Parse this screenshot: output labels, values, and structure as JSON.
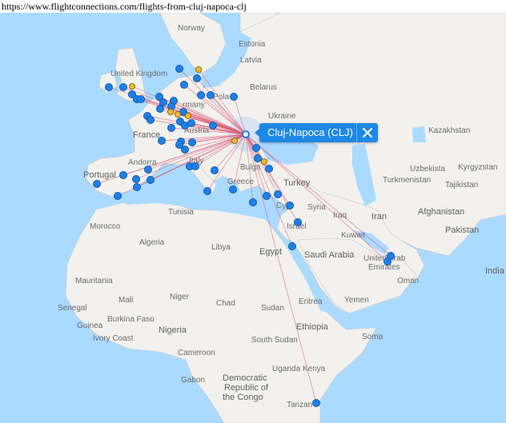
{
  "browser": {
    "url": "https://www.flightconnections.com/flights-from-cluj-napoca-clj"
  },
  "popup": {
    "label": "Cluj-Napoca (CLJ)",
    "close_icon": "close-icon"
  },
  "colors": {
    "water": "#aadaff",
    "land": "#f2f1ee",
    "route": "#d9536f",
    "airport": "#1e7fe8",
    "airport_alt": "#f5b82e",
    "popup": "#1e88e5"
  },
  "labels": {
    "norway": "Norway",
    "estonia": "Estonia",
    "latvia": "Latvia",
    "belarus": "Belarus",
    "uk": "United Kingdom",
    "poland": "Pola",
    "germany": "rmany",
    "ukraine": "Ukraine",
    "kazakhstan": "Kazakhstan",
    "france": "France",
    "austria": "Austria",
    "bulgaria": "Bulga",
    "andorra": "Andorra",
    "italy": "Italy",
    "portugal": "Portugal",
    "greece": "Greece",
    "turkey": "Turkey",
    "uzbekistan": "Uzbekista",
    "kyrgyzstan": "Kyrgyzstan",
    "turkmenistan": "Turkmenistan",
    "tajikistan": "Tajikistan",
    "cyprus": "Cyp",
    "syria": "Syria",
    "iraq": "Iraq",
    "iran": "Iran",
    "afghanistan": "Afghanistan",
    "pakistan": "Pakistan",
    "morocco": "Morocco",
    "tunisia": "Tunisia",
    "israel": "Israel",
    "kuwait": "Kuwait",
    "algeria": "Algeria",
    "libya": "Libya",
    "egypt": "Egypt",
    "saudi_arabia": "Saudi Arabia",
    "uae_1": "United Arab",
    "uae_2": "Emirates",
    "oman": "Oman",
    "india": "India",
    "mauritania": "Mauritania",
    "mali": "Mali",
    "niger": "Niger",
    "chad": "Chad",
    "sudan": "Sudan",
    "eritrea": "Eritrea",
    "yemen": "Yemen",
    "senegal": "Senegal",
    "guinea": "Guinea",
    "burkina_faso": "Burkina Faso",
    "ivory_coast": "Ivory Coast",
    "nigeria": "Nigeria",
    "ethiopia": "Ethiopia",
    "south_sudan": "South Sudan",
    "somalia": "Soma",
    "cameroon": "Cameroon",
    "gabon": "Gabon",
    "uganda": "Uganda",
    "kenya": "Kenya",
    "drc_1": "Democratic",
    "drc_2": "Republic of",
    "drc_3": "the Congo",
    "tanzania": "Tanzan"
  }
}
